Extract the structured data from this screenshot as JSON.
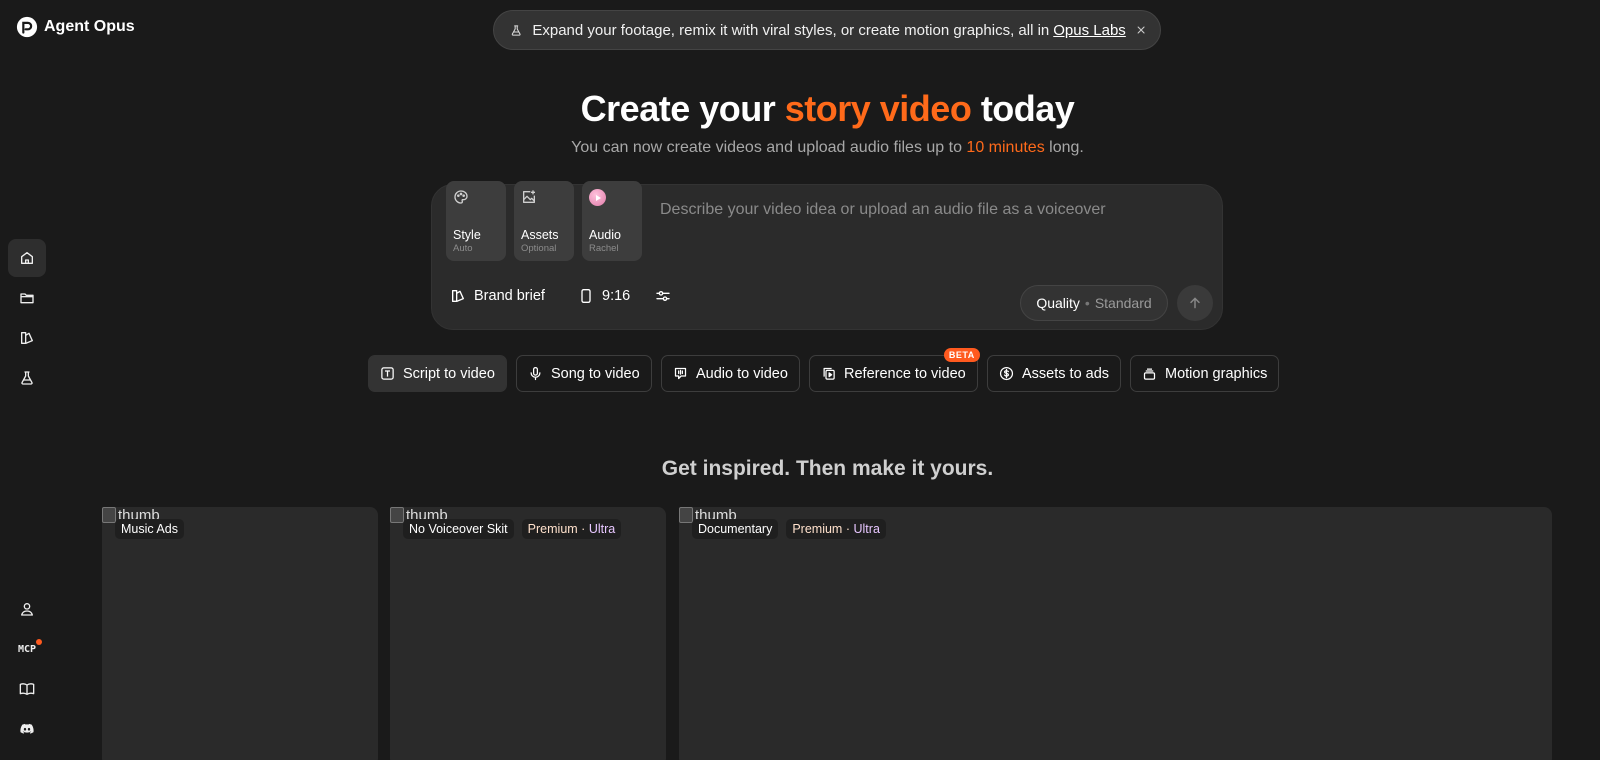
{
  "app": {
    "name": "Agent Opus"
  },
  "announcement": {
    "text": "Expand your footage, remix it with viral styles, or create motion graphics, all in",
    "link": "Opus Labs"
  },
  "sidebar": {
    "top_items": [
      "home-icon",
      "folder-icon",
      "brand-icon",
      "flask-icon"
    ],
    "bottom_items": [
      "user-icon",
      "mcp",
      "book-icon",
      "discord-icon"
    ],
    "mcp_label": "MCP"
  },
  "hero": {
    "title_pre": "Create your ",
    "title_accent": "story video",
    "title_post": " today",
    "sub_pre": "You can now create videos and upload audio files up to ",
    "sub_accent": "10 minutes",
    "sub_post": " long.",
    "accent_color": "#ff6a1a"
  },
  "composer": {
    "placeholder": "Describe your video idea or upload an audio file as a voiceover",
    "chips": [
      {
        "label": "Style",
        "sub": "Auto"
      },
      {
        "label": "Assets",
        "sub": "Optional"
      },
      {
        "label": "Audio",
        "sub": "Rachel"
      }
    ],
    "brand_brief": "Brand brief",
    "aspect": "9:16",
    "quality_label": "Quality",
    "quality_sep": "•",
    "quality_value": "Standard"
  },
  "modes": [
    {
      "label": "Script to video"
    },
    {
      "label": "Song to video"
    },
    {
      "label": "Audio to video"
    },
    {
      "label": "Reference to video",
      "badge": "BETA"
    },
    {
      "label": "Assets to ads"
    },
    {
      "label": "Motion graphics"
    }
  ],
  "inspire": "Get inspired. Then make it yours.",
  "cards": [
    {
      "alt": "thumb",
      "title": "Music Ads"
    },
    {
      "alt": "thumb",
      "title": "No Voiceover Skit",
      "premium": "Premium",
      "sep": "·",
      "ultra": "Ultra"
    },
    {
      "alt": "thumb",
      "title": "Documentary",
      "premium": "Premium",
      "sep": "·",
      "ultra": "Ultra"
    }
  ]
}
